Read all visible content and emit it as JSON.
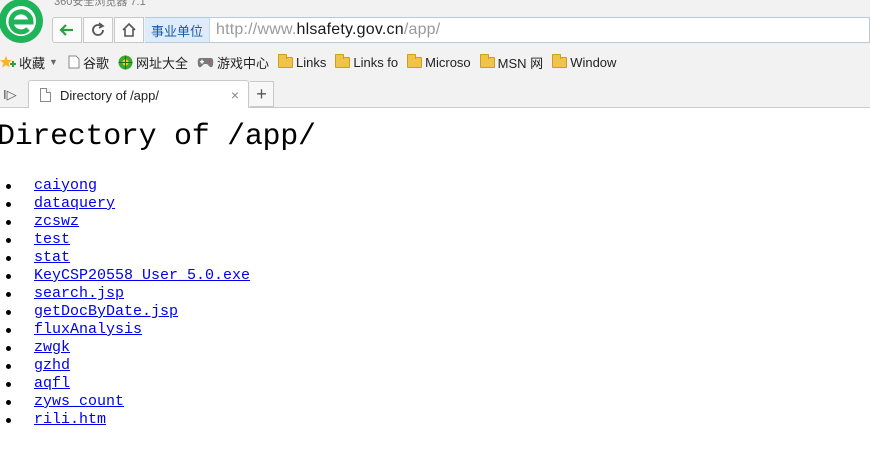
{
  "browser": {
    "app_title": "360安全浏览器 7.1",
    "address": {
      "site_badge": "事业单位",
      "url_prefix": "http://www.",
      "url_domain": "hlsafety.gov.cn",
      "url_path": "/app/"
    },
    "bookmarks": {
      "favorites": "收藏",
      "items": [
        {
          "label": "谷歌",
          "icon": "page-icon"
        },
        {
          "label": "网址大全",
          "icon": "globe-icon"
        },
        {
          "label": "游戏中心",
          "icon": "gamepad-icon"
        },
        {
          "label": "Links",
          "icon": "folder-icon"
        },
        {
          "label": "Links fo",
          "icon": "folder-icon"
        },
        {
          "label": "Microso",
          "icon": "folder-icon"
        },
        {
          "label": "MSN 网",
          "icon": "folder-icon"
        },
        {
          "label": "Window",
          "icon": "folder-icon"
        }
      ]
    },
    "tabs": [
      {
        "title": "Directory of /app/",
        "active": true
      }
    ],
    "new_tab_symbol": "+",
    "close_symbol": "×",
    "sidebar_symbol": "I▷",
    "colors": {
      "brand_green": "#1fb35a",
      "nav_arrow_green": "#2e9e3e",
      "link_blue": "#0000ee",
      "badge_bg": "#dcecfb"
    }
  },
  "page": {
    "heading": "Directory of /app/",
    "entries": [
      {
        "name": "caiyong"
      },
      {
        "name": "dataquery"
      },
      {
        "name": "zcswz"
      },
      {
        "name": "test"
      },
      {
        "name": "stat"
      },
      {
        "name": "KeyCSP20558_User_5.0.exe"
      },
      {
        "name": "search.jsp"
      },
      {
        "name": "getDocByDate.jsp"
      },
      {
        "name": "fluxAnalysis"
      },
      {
        "name": "zwgk"
      },
      {
        "name": "gzhd"
      },
      {
        "name": "aqfl"
      },
      {
        "name": "zyws_count"
      },
      {
        "name": "rili.htm"
      }
    ]
  }
}
